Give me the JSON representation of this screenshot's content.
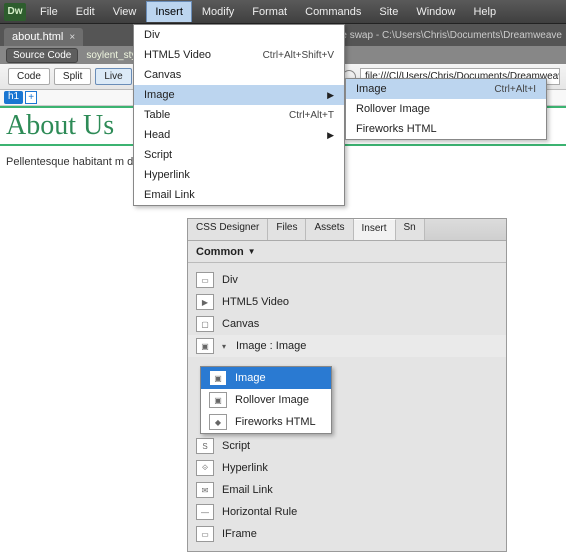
{
  "menubar": {
    "items": [
      "File",
      "Edit",
      "View",
      "Insert",
      "Modify",
      "Format",
      "Commands",
      "Site",
      "Window",
      "Help"
    ],
    "active": 3
  },
  "doc_tab": {
    "name": "about.html",
    "close": "×"
  },
  "sourcebar": {
    "label": "Source Code",
    "link": "soylent_styles"
  },
  "title_right": "age swap - C:\\Users\\Chris\\Documents\\Dreamweave",
  "toolbar": {
    "code": "Code",
    "split": "Split",
    "live": "Live",
    "chev": "▼",
    "url_label": "file:///C|/Users/Chris/Documents/Dreamweav"
  },
  "livetag": {
    "tag": "h1",
    "add": "+"
  },
  "heading": "About Us",
  "body_text": "Pellentesque habitant m                                                                                                  da fames ac turpis egestas. Vestibulum tort",
  "insert_menu": {
    "items": [
      {
        "label": "Div"
      },
      {
        "label": "HTML5 Video",
        "shortcut": "Ctrl+Alt+Shift+V"
      },
      {
        "label": "Canvas"
      },
      {
        "label": "Image",
        "submenu": true,
        "hi": true
      },
      {
        "label": "Table",
        "shortcut": "Ctrl+Alt+T"
      },
      {
        "label": "Head",
        "submenu": true
      },
      {
        "label": "Script"
      },
      {
        "label": "Hyperlink"
      },
      {
        "label": "Email Link"
      }
    ]
  },
  "image_submenu": {
    "items": [
      {
        "label": "Image",
        "shortcut": "Ctrl+Alt+I",
        "hi": true
      },
      {
        "label": "Rollover Image"
      },
      {
        "label": "Fireworks HTML"
      }
    ]
  },
  "panel": {
    "tabs": [
      "CSS Designer",
      "Files",
      "Assets",
      "Insert",
      "Sn"
    ],
    "active_tab": 3,
    "category": "Common",
    "items": [
      "Div",
      "HTML5 Video",
      "Canvas",
      "Image : Image",
      "Script",
      "Hyperlink",
      "Email Link",
      "Horizontal Rule",
      "IFrame"
    ],
    "selected_index": 3,
    "popup": [
      "Image",
      "Rollover Image",
      "Fireworks HTML"
    ]
  }
}
